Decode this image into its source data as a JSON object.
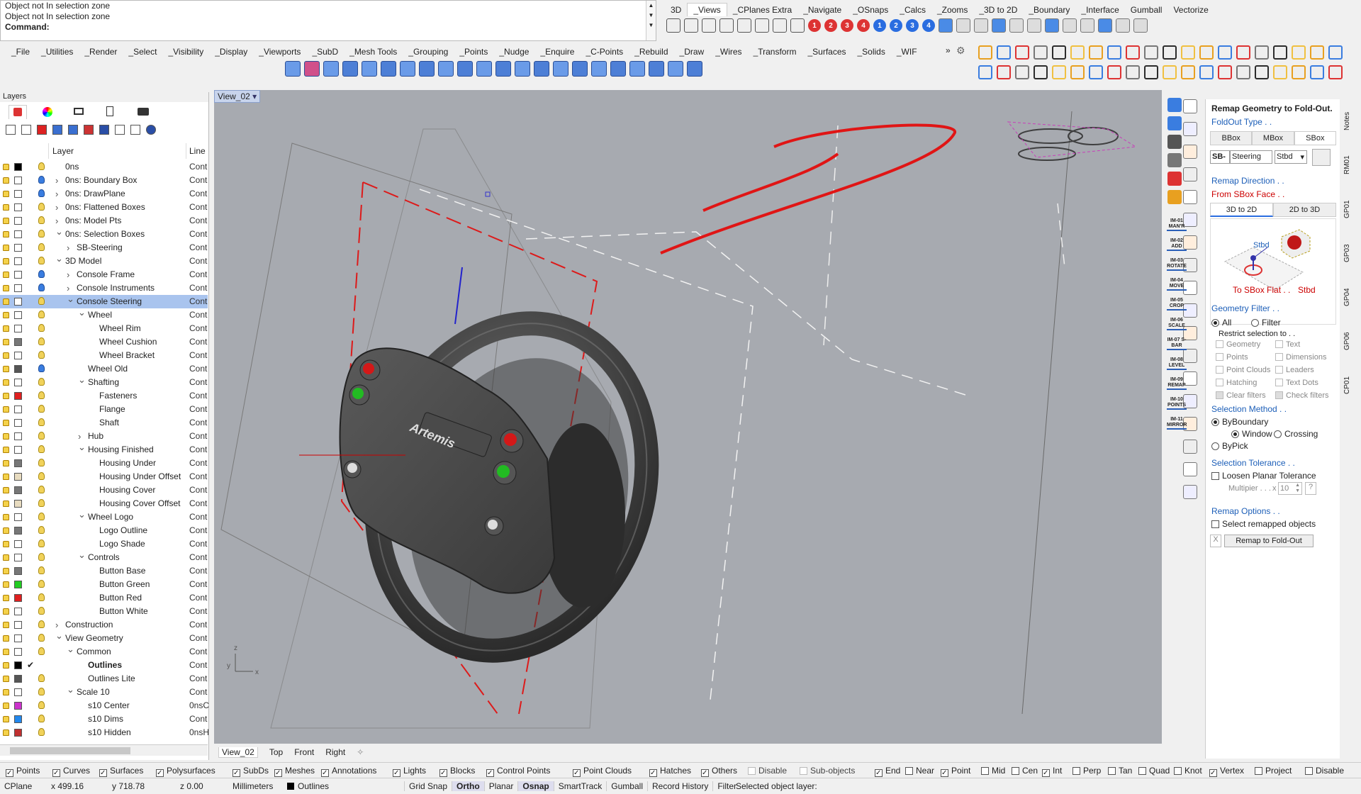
{
  "command": {
    "lines": [
      "Object not In selection zone",
      "Object not In selection zone"
    ],
    "prompt": "Command:"
  },
  "tabs_top": [
    "3D",
    "_Views",
    "_CPlanes Extra",
    "_Navigate",
    "_OSnaps",
    "_Calcs",
    "_Zooms",
    "_3D to 2D",
    "_Boundary",
    "_Interface",
    "Gumball",
    "Vectorize"
  ],
  "tabs_main": [
    "_File",
    "_Utilities",
    "_Render",
    "_Select",
    "_Visibility",
    "_Display",
    "_Viewports",
    "_SubD",
    "_Mesh Tools",
    "_Grouping",
    "_Points",
    "_Nudge",
    "_Enquire",
    "_C-Points",
    "_Rebuild",
    "_Draw",
    "_Wires",
    "_Transform",
    "_Surfaces",
    "_Solids",
    "_WIF"
  ],
  "numbered_views": [
    "1",
    "2",
    "3",
    "4",
    "1",
    "2",
    "3",
    "4"
  ],
  "layers_panel": {
    "title": "Layers",
    "col_layer": "Layer",
    "col_line": "Line",
    "rows": [
      {
        "name": "0ns",
        "line": "Cont",
        "indent": 0,
        "exp": "",
        "color": "#000000",
        "bulb": "yellow"
      },
      {
        "name": "0ns: Boundary Box",
        "line": "Cont",
        "indent": 0,
        "exp": ">",
        "color": "#ffffff",
        "bulb": "blue"
      },
      {
        "name": "0ns: DrawPlane",
        "line": "Cont",
        "indent": 0,
        "exp": ">",
        "color": "#ffffff",
        "bulb": "blue"
      },
      {
        "name": "0ns: Flattened Boxes",
        "line": "Cont",
        "indent": 0,
        "exp": ">",
        "color": "#ffffff",
        "bulb": "yellow"
      },
      {
        "name": "0ns: Model Pts",
        "line": "Cont",
        "indent": 0,
        "exp": ">",
        "color": "#ffffff",
        "bulb": "yellow"
      },
      {
        "name": "0ns: Selection Boxes",
        "line": "Cont",
        "indent": 0,
        "exp": "v",
        "color": "#ffffff",
        "bulb": "yellow"
      },
      {
        "name": "SB-Steering",
        "line": "Cont",
        "indent": 1,
        "exp": ">",
        "color": "#ffffff",
        "bulb": "yellow"
      },
      {
        "name": "3D Model",
        "line": "Cont",
        "indent": 0,
        "exp": "v",
        "color": "#ffffff",
        "bulb": "yellow"
      },
      {
        "name": "Console Frame",
        "line": "Cont",
        "indent": 1,
        "exp": ">",
        "color": "#ffffff",
        "bulb": "blue"
      },
      {
        "name": "Console Instruments",
        "line": "Cont",
        "indent": 1,
        "exp": ">",
        "color": "#ffffff",
        "bulb": "blue"
      },
      {
        "name": "Console Steering",
        "line": "Cont",
        "indent": 1,
        "exp": "v",
        "color": "#ffffff",
        "bulb": "yellow",
        "selected": true
      },
      {
        "name": "Wheel",
        "line": "Cont",
        "indent": 2,
        "exp": "v",
        "color": "#ffffff",
        "bulb": "yellow"
      },
      {
        "name": "Wheel Rim",
        "line": "Cont",
        "indent": 3,
        "exp": "",
        "color": "#ffffff",
        "bulb": "yellow"
      },
      {
        "name": "Wheel Cushion",
        "line": "Cont",
        "indent": 3,
        "exp": "",
        "color": "#777777",
        "bulb": "yellow"
      },
      {
        "name": "Wheel Bracket",
        "line": "Cont",
        "indent": 3,
        "exp": "",
        "color": "#ffffff",
        "bulb": "yellow"
      },
      {
        "name": "Wheel Old",
        "line": "Cont",
        "indent": 2,
        "exp": "",
        "color": "#555555",
        "bulb": "blue"
      },
      {
        "name": "Shafting",
        "line": "Cont",
        "indent": 2,
        "exp": "v",
        "color": "#ffffff",
        "bulb": "yellow"
      },
      {
        "name": "Fasteners",
        "line": "Cont",
        "indent": 3,
        "exp": "",
        "color": "#e02020",
        "bulb": "yellow"
      },
      {
        "name": "Flange",
        "line": "Cont",
        "indent": 3,
        "exp": "",
        "color": "#ffffff",
        "bulb": "yellow"
      },
      {
        "name": "Shaft",
        "line": "Cont",
        "indent": 3,
        "exp": "",
        "color": "#ffffff",
        "bulb": "yellow"
      },
      {
        "name": "Hub",
        "line": "Cont",
        "indent": 2,
        "exp": ">",
        "color": "#ffffff",
        "bulb": "yellow"
      },
      {
        "name": "Housing Finished",
        "line": "Cont",
        "indent": 2,
        "exp": "v",
        "color": "#ffffff",
        "bulb": "yellow"
      },
      {
        "name": "Housing Under",
        "line": "Cont",
        "indent": 3,
        "exp": "",
        "color": "#777777",
        "bulb": "yellow"
      },
      {
        "name": "Housing Under Offset",
        "line": "Cont",
        "indent": 3,
        "exp": "",
        "color": "#e8dcc0",
        "bulb": "yellow"
      },
      {
        "name": "Housing Cover",
        "line": "Cont",
        "indent": 3,
        "exp": "",
        "color": "#777777",
        "bulb": "yellow"
      },
      {
        "name": "Housing Cover Offset",
        "line": "Cont",
        "indent": 3,
        "exp": "",
        "color": "#e8dcc0",
        "bulb": "yellow"
      },
      {
        "name": "Wheel Logo",
        "line": "Cont",
        "indent": 2,
        "exp": "v",
        "color": "#ffffff",
        "bulb": "yellow"
      },
      {
        "name": "Logo Outline",
        "line": "Cont",
        "indent": 3,
        "exp": "",
        "color": "#777777",
        "bulb": "yellow"
      },
      {
        "name": "Logo Shade",
        "line": "Cont",
        "indent": 3,
        "exp": "",
        "color": "#ffffff",
        "bulb": "yellow"
      },
      {
        "name": "Controls",
        "line": "Cont",
        "indent": 2,
        "exp": "v",
        "color": "#ffffff",
        "bulb": "yellow"
      },
      {
        "name": "Button Base",
        "line": "Cont",
        "indent": 3,
        "exp": "",
        "color": "#777777",
        "bulb": "yellow"
      },
      {
        "name": "Button Green",
        "line": "Cont",
        "indent": 3,
        "exp": "",
        "color": "#22cc22",
        "bulb": "yellow"
      },
      {
        "name": "Button Red",
        "line": "Cont",
        "indent": 3,
        "exp": "",
        "color": "#e02020",
        "bulb": "yellow"
      },
      {
        "name": "Button White",
        "line": "Cont",
        "indent": 3,
        "exp": "",
        "color": "#ffffff",
        "bulb": "yellow"
      },
      {
        "name": "Construction",
        "line": "Cont",
        "indent": 0,
        "exp": ">",
        "color": "#ffffff",
        "bulb": "yellow"
      },
      {
        "name": "View Geometry",
        "line": "Cont",
        "indent": 0,
        "exp": "v",
        "color": "#ffffff",
        "bulb": "yellow"
      },
      {
        "name": "Common",
        "line": "Cont",
        "indent": 1,
        "exp": "v",
        "color": "#ffffff",
        "bulb": "yellow"
      },
      {
        "name": "Outlines",
        "line": "Cont",
        "indent": 2,
        "exp": "",
        "color": "#000000",
        "bulb": "check",
        "bold": true
      },
      {
        "name": "Outlines Lite",
        "line": "Cont",
        "indent": 2,
        "exp": "",
        "color": "#555555",
        "bulb": "yellow"
      },
      {
        "name": "Scale 10",
        "line": "Cont",
        "indent": 1,
        "exp": "v",
        "color": "#ffffff",
        "bulb": "yellow"
      },
      {
        "name": "s10 Center",
        "line": "0nsC",
        "indent": 2,
        "exp": "",
        "color": "#cc33cc",
        "bulb": "yellow"
      },
      {
        "name": "s10 Dims",
        "line": "Cont",
        "indent": 2,
        "exp": "",
        "color": "#2288ee",
        "bulb": "yellow"
      },
      {
        "name": "s10 Hidden",
        "line": "0nsH",
        "indent": 2,
        "exp": "",
        "color": "#c03030",
        "bulb": "yellow"
      }
    ]
  },
  "viewport": {
    "title": "View_02",
    "logo": "Artemis"
  },
  "view_tabs": [
    "View_02",
    "Top",
    "Front",
    "Right"
  ],
  "side_tools": [
    "IM-01 MAN'R",
    "IM-02 ADD",
    "IM-03 ROTATE",
    "IM-04 MOVE",
    "IM-05 CROP",
    "IM-06 SCALE",
    "IM-07 S-BAR",
    "IM-08 LEVEL",
    "IM-09 REMAP",
    "IM-10 POINTS",
    "IM-11 MIRROR"
  ],
  "right_vtabs": [
    "Notes",
    "RM01",
    "GP01",
    "GP03",
    "GP04",
    "GP06",
    "CP01"
  ],
  "remap": {
    "title": "Remap Geometry to Fold-Out.",
    "foldout_type": "FoldOut Type . .",
    "type_tabs": [
      "BBox",
      "MBox",
      "SBox"
    ],
    "sb_prefix": "SB-",
    "sb_value": "Steering",
    "sb_select": "Stbd",
    "remap_direction": "Remap Direction . .",
    "from_face": "From SBox Face . .",
    "dir_tabs": [
      "3D to 2D",
      "2D to 3D"
    ],
    "diagram_label": "Stbd",
    "to_flat": "To SBox Flat . .",
    "to_flat_val": "Stbd",
    "geometry_filter": "Geometry Filter . .",
    "gf_all": "All",
    "gf_filter": "Filter",
    "restrict": "Restrict selection to . .",
    "gf_items": [
      "Geometry",
      "Text",
      "Points",
      "Dimensions",
      "Point Clouds",
      "Leaders",
      "Hatching",
      "Text Dots",
      "Clear filters",
      "Check filters"
    ],
    "selection_method": "Selection Method . .",
    "by_boundary": "ByBoundary",
    "window": "Window",
    "crossing": "Crossing",
    "by_pick": "ByPick",
    "selection_tolerance": "Selection Tolerance . .",
    "loosen": "Loosen Planar Tolerance",
    "multiplier": "Multipier . . .",
    "mult_x": "x",
    "mult_val": "10",
    "help": "?",
    "remap_options": "Remap Options . .",
    "select_remapped": "Select remapped objects",
    "cancel": "X",
    "remap_btn": "Remap to Fold-Out"
  },
  "filters": [
    {
      "label": "Points",
      "on": true
    },
    {
      "label": "Curves",
      "on": true
    },
    {
      "label": "Surfaces",
      "on": true
    },
    {
      "label": "Polysurfaces",
      "on": true
    },
    {
      "label": "SubDs",
      "on": true
    },
    {
      "label": "Meshes",
      "on": true
    },
    {
      "label": "Annotations",
      "on": true
    },
    {
      "label": "Lights",
      "on": true
    },
    {
      "label": "Blocks",
      "on": true
    },
    {
      "label": "Control Points",
      "on": true
    },
    {
      "label": "Point Clouds",
      "on": true
    },
    {
      "label": "Hatches",
      "on": true
    },
    {
      "label": "Others",
      "on": true
    },
    {
      "label": "Disable",
      "on": false
    },
    {
      "label": "Sub-objects",
      "on": false
    }
  ],
  "osnaps": [
    {
      "label": "End",
      "on": true
    },
    {
      "label": "Near",
      "on": false
    },
    {
      "label": "Point",
      "on": true
    },
    {
      "label": "Mid",
      "on": false
    },
    {
      "label": "Cen",
      "on": false
    },
    {
      "label": "Int",
      "on": true
    },
    {
      "label": "Perp",
      "on": false
    },
    {
      "label": "Tan",
      "on": false
    },
    {
      "label": "Quad",
      "on": false
    },
    {
      "label": "Knot",
      "on": false
    },
    {
      "label": "Vertex",
      "on": true
    },
    {
      "label": "Project",
      "on": false
    },
    {
      "label": "Disable",
      "on": false
    }
  ],
  "statusbar": {
    "cplane": "CPlane",
    "x": "x 499.16",
    "y": "y 718.78",
    "z": "z 0.00",
    "units": "Millimeters",
    "layer": "Outlines",
    "items": [
      "Grid Snap",
      "Ortho",
      "Planar",
      "Osnap",
      "SmartTrack",
      "Gumball",
      "Record History",
      "Filter"
    ],
    "active": [
      "Ortho",
      "Osnap"
    ],
    "msg": "Selected object layer:"
  }
}
